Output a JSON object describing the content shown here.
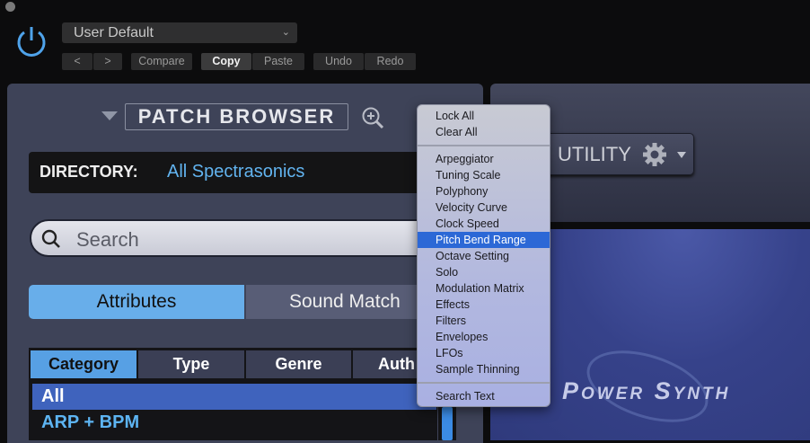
{
  "host": {
    "preset": "User Default",
    "buttons": {
      "prev": "<",
      "next": ">",
      "compare": "Compare",
      "copy": "Copy",
      "paste": "Paste",
      "undo": "Undo",
      "redo": "Redo"
    }
  },
  "browser": {
    "title": "PATCH BROWSER",
    "directory_label": "DIRECTORY:",
    "directory_value": "All Spectrasonics",
    "search_placeholder": "Search",
    "tabs": [
      "Attributes",
      "Sound Match"
    ],
    "columns": [
      "Category",
      "Type",
      "Genre",
      "Auth"
    ],
    "rows": [
      "All",
      "ARP + BPM"
    ]
  },
  "utility": {
    "label": "UTILITY"
  },
  "logo": "Power Synth",
  "menu": {
    "group1": [
      "Lock All",
      "Clear All"
    ],
    "group2": [
      "Arpeggiator",
      "Tuning Scale",
      "Polyphony",
      "Velocity Curve",
      "Clock Speed",
      "Pitch Bend Range",
      "Octave Setting",
      "Solo",
      "Modulation Matrix",
      "Effects",
      "Filters",
      "Envelopes",
      "LFOs",
      "Sample Thinning"
    ],
    "group3": [
      "Search Text"
    ],
    "highlighted": "Pitch Bend Range"
  },
  "colors": {
    "accent": "#68aeea",
    "highlight": "#2c68d6",
    "directory": "#62b4f0"
  }
}
